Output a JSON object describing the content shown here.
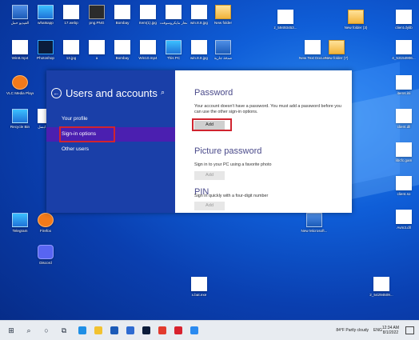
{
  "desktop": {
    "icons": [
      {
        "label": "الفيديو حمل",
        "kind": "word"
      },
      {
        "label": "whatsapp",
        "kind": "app"
      },
      {
        "label": "17.webp",
        "kind": "file"
      },
      {
        "label": "png.PNG",
        "kind": "dark"
      },
      {
        "label": "Bombay",
        "kind": "file"
      },
      {
        "label": "Item(1).jpg",
        "kind": "file"
      },
      {
        "label": "شعار مايكروسوفت",
        "kind": "file"
      },
      {
        "label": "win.8.8.jpg",
        "kind": "file"
      },
      {
        "label": "New folder",
        "kind": "folder"
      },
      {
        "label": "z_59493453...",
        "kind": "file"
      },
      {
        "label": "New folder (3)",
        "kind": "folder"
      },
      {
        "label": "client.dylib",
        "kind": "file"
      },
      {
        "label": "Win8.mp4",
        "kind": "file"
      },
      {
        "label": "Photoshop",
        "kind": "ps"
      },
      {
        "label": "13.jpg",
        "kind": "file"
      },
      {
        "label": "a",
        "kind": "file"
      },
      {
        "label": "Bombay",
        "kind": "file"
      },
      {
        "label": "Win10.mp4",
        "kind": "file"
      },
      {
        "label": "This PC",
        "kind": "app"
      },
      {
        "label": "win.8.8.jpg",
        "kind": "file"
      },
      {
        "label": "صدقة جارية",
        "kind": "word"
      },
      {
        "label": "New Text Document...",
        "kind": "file"
      },
      {
        "label": "New folder (7)",
        "kind": "folder"
      },
      {
        "label": "4_53154906...",
        "kind": "file"
      },
      {
        "label": "VLC Media Player",
        "kind": "orange"
      },
      {
        "label": "items.ini",
        "kind": "file"
      },
      {
        "label": "Recycle Bin",
        "kind": "app"
      },
      {
        "label": "client.dll",
        "kind": "file"
      },
      {
        "label": "ابسل.wav",
        "kind": "file"
      },
      {
        "label": "libcfc.gam",
        "kind": "file"
      },
      {
        "label": "client.so",
        "kind": "file"
      },
      {
        "label": "Avm3.dll",
        "kind": "file"
      },
      {
        "label": "Telegram",
        "kind": "app"
      },
      {
        "label": "Firefox",
        "kind": "orange"
      },
      {
        "label": "Discord",
        "kind": "discord"
      },
      {
        "label": "New Microsoft...",
        "kind": "word"
      },
      {
        "label": "x.bat.exe",
        "kind": "file"
      },
      {
        "label": "2_54294509...",
        "kind": "file"
      }
    ]
  },
  "settings": {
    "back_label": "←",
    "title": "Users and accounts",
    "search_icon_glyph": "⌕",
    "nav": [
      {
        "label": "Your profile",
        "selected": false
      },
      {
        "label": "Sign-in options",
        "selected": true
      },
      {
        "label": "Other users",
        "selected": false
      }
    ],
    "password": {
      "title": "Password",
      "text": "Your account doesn't have a password. You must add a password before you can use the other sign-in options.",
      "button": "Add"
    },
    "picture_password": {
      "title": "Picture password",
      "text": "Sign in to your PC using a favorite photo",
      "button": "Add"
    },
    "pin": {
      "title": "PIN",
      "text": "Sign in quickly with a four-digit number",
      "button": "Add"
    }
  },
  "taskbar": {
    "start_glyph": "⊞",
    "search_glyph": "⌕",
    "cortana_glyph": "○",
    "taskview_glyph": "⧉",
    "apps": [
      {
        "name": "edge-icon",
        "color": "#1f8fe6"
      },
      {
        "name": "file-explorer-icon",
        "color": "#f2c230"
      },
      {
        "name": "store-icon",
        "color": "#1c5bb8"
      },
      {
        "name": "mail-icon",
        "color": "#2e6bd1"
      },
      {
        "name": "photoshop-icon",
        "color": "#0b1c3a"
      },
      {
        "name": "chrome-icon",
        "color": "#e23b2e"
      },
      {
        "name": "opera-icon",
        "color": "#d8222e"
      },
      {
        "name": "media-icon",
        "color": "#2a8af0"
      }
    ],
    "weather": "84°F  Partly cloudy",
    "language": "ENG",
    "time": "12:34 AM",
    "date": "8/1/2022"
  }
}
